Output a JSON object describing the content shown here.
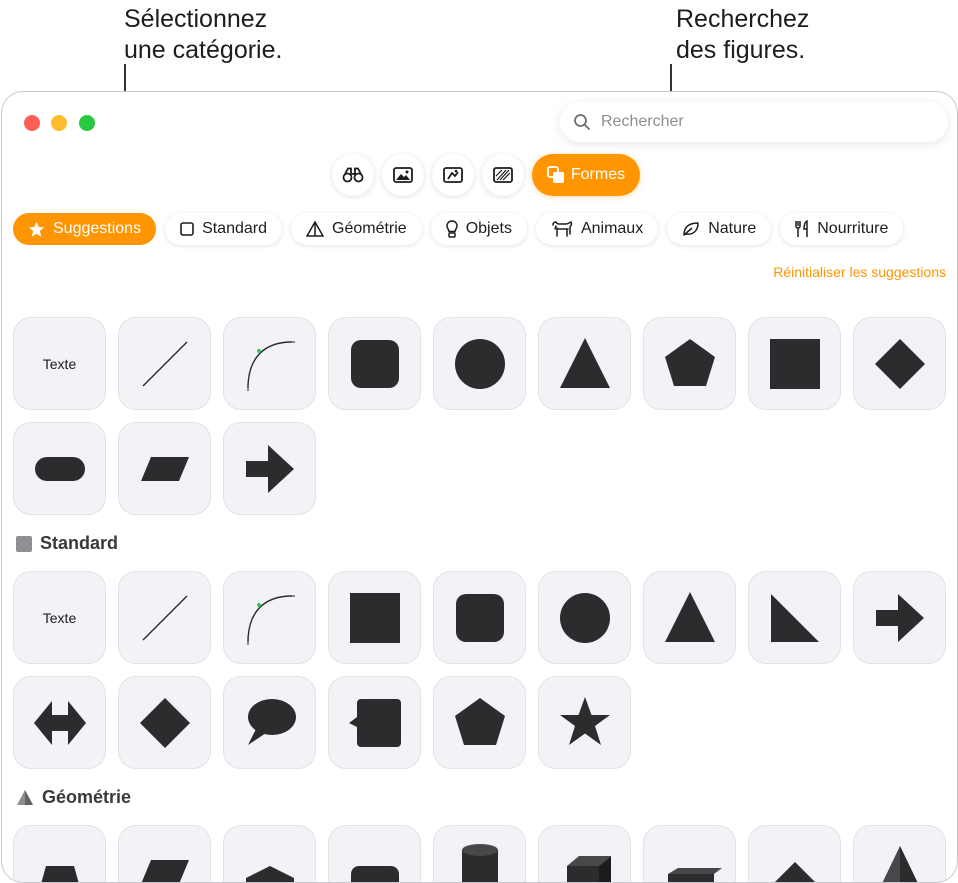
{
  "callouts": {
    "category": [
      "Sélectionnez",
      "une catégorie."
    ],
    "search": [
      "Recherchez",
      "des figures."
    ]
  },
  "search": {
    "placeholder": "Rechercher"
  },
  "toolbar": {
    "tabs": [
      {
        "icon": "binoculars-icon"
      },
      {
        "icon": "photo-icon"
      },
      {
        "icon": "media-icon"
      },
      {
        "icon": "texture-icon"
      },
      {
        "icon": "shapes-icon",
        "label": "Formes",
        "active": true
      }
    ]
  },
  "categories": [
    {
      "label": "Suggestions",
      "icon": "star-icon",
      "active": true
    },
    {
      "label": "Standard",
      "icon": "square-icon"
    },
    {
      "label": "Géométrie",
      "icon": "pyramid-icon"
    },
    {
      "label": "Objets",
      "icon": "lightbulb-icon"
    },
    {
      "label": "Animaux",
      "icon": "animal-icon"
    },
    {
      "label": "Nature",
      "icon": "leaf-icon"
    },
    {
      "label": "Nourriture",
      "icon": "fork-knife-icon"
    }
  ],
  "reset_label": "Réinitialiser les suggestions",
  "suggestions": {
    "tiles": [
      "Texte",
      "line",
      "curve",
      "rounded-square",
      "circle",
      "triangle",
      "pentagon",
      "square",
      "diamond",
      "pill",
      "parallelogram",
      "arrow-right"
    ]
  },
  "standard": {
    "title": "Standard",
    "tiles": [
      "Texte",
      "line",
      "curve",
      "square",
      "rounded-square",
      "circle",
      "triangle",
      "right-triangle",
      "arrow-right",
      "double-arrow",
      "diamond",
      "speech-bubble",
      "callout-box",
      "pentagon",
      "star"
    ]
  },
  "geometry": {
    "title": "Géométrie",
    "tiles": [
      "trapezoid",
      "parallelogram",
      "hexagon",
      "rounded-rect",
      "cylinder",
      "cube",
      "box",
      "pyramid",
      "pyramid-2"
    ]
  },
  "colors": {
    "accent": "#ff9500",
    "shape": "#2c2c2e",
    "tile": "#f2f2f7"
  }
}
